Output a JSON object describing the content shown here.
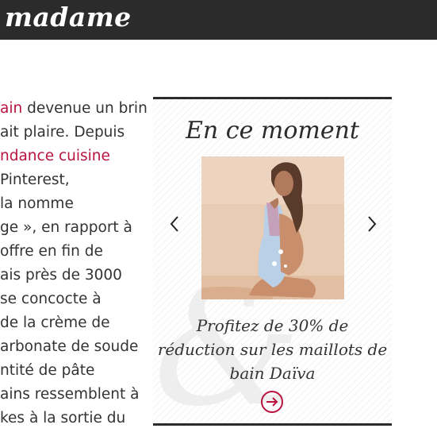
{
  "header": {
    "logo": "madame"
  },
  "article": {
    "lines": [
      {
        "pre": "",
        "link": "ain",
        "post": " devenue un brin"
      },
      {
        "pre": "ait plaire. Depuis",
        "link": "",
        "post": ""
      },
      {
        "pre": "",
        "link": "ndance cuisine",
        "post": ""
      },
      {
        "pre": " Pinterest,",
        "link": "",
        "post": ""
      },
      {
        "pre": " la nomme",
        "link": "",
        "post": ""
      },
      {
        "pre": "ge », en rapport à",
        "link": "",
        "post": ""
      },
      {
        "pre": " offre en fin de",
        "link": "",
        "post": ""
      },
      {
        "pre": "ais près de 3000",
        "link": "",
        "post": ""
      },
      {
        "pre": " se concocte à",
        "link": "",
        "post": ""
      },
      {
        "pre": " de la crème de",
        "link": "",
        "post": ""
      },
      {
        "pre": "arbonate de soude",
        "link": "",
        "post": ""
      },
      {
        "pre": "ntité de pâte",
        "link": "",
        "post": ""
      },
      {
        "pre": "ains ressemblent à",
        "link": "",
        "post": ""
      },
      {
        "pre": "kes à la sortie du",
        "link": "",
        "post": ""
      }
    ]
  },
  "widget": {
    "title": "En ce moment",
    "promo_lines": [
      "Profitez de 30% de",
      "réduction sur les maillots de",
      "bain Daïva"
    ],
    "prev_icon": "chevron-left-icon",
    "next_icon": "chevron-right-icon",
    "go_icon": "arrow-right-circle-icon"
  },
  "colors": {
    "header_bg": "#2b2b2b",
    "link": "#b8123f",
    "text": "#333333"
  }
}
